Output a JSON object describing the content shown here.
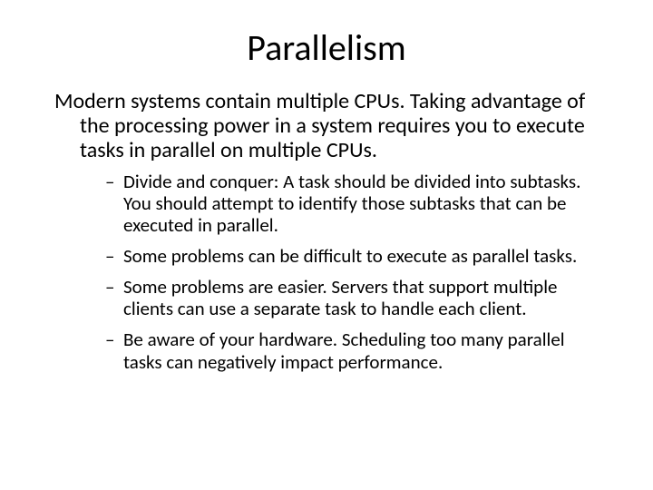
{
  "slide": {
    "title": "Parallelism",
    "intro": "Modern systems contain multiple CPUs. Taking advantage of the processing power in a system requires you to execute tasks in parallel on multiple CPUs.",
    "bullets": [
      "Divide and conquer: A task should be divided into subtasks. You should attempt to identify those subtasks that can be executed in parallel.",
      "Some problems can be difficult to execute as parallel tasks.",
      "Some problems are easier. Servers that support multiple clients can use a separate task to handle each client.",
      "Be aware of your hardware. Scheduling too many parallel tasks can negatively impact performance."
    ]
  }
}
